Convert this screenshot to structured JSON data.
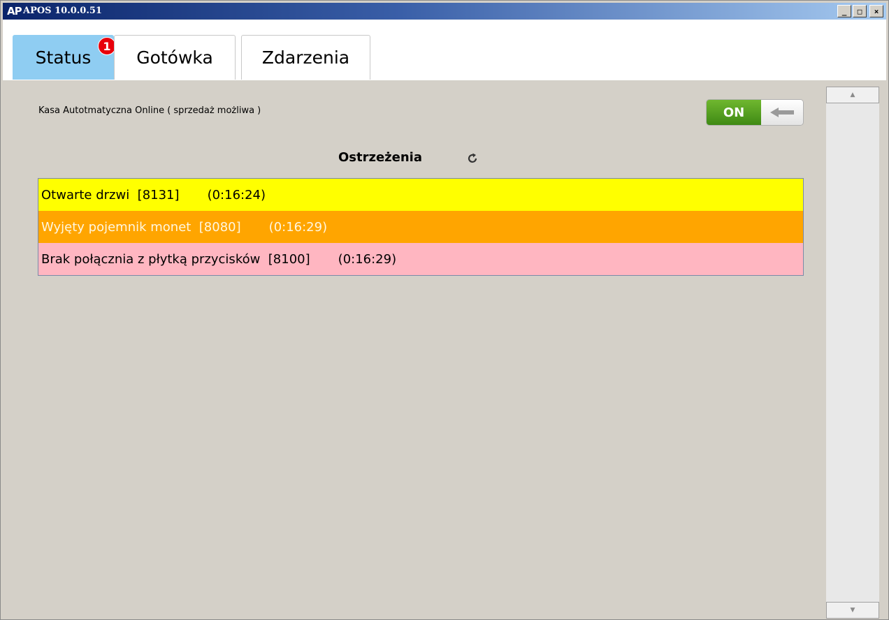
{
  "window": {
    "logo": "AP",
    "title": "APOS 10.0.0.51",
    "min_glyph": "_",
    "max_glyph": "□",
    "close_glyph": "×"
  },
  "tabs": [
    {
      "label": "Status",
      "badge": "1",
      "active": true
    },
    {
      "label": "Gotówka",
      "active": false
    },
    {
      "label": "Zdarzenia",
      "active": false
    }
  ],
  "status": {
    "text": "Kasa Autotmatyczna Online ( sprzedaż możliwa )",
    "toggle_label": "ON"
  },
  "warnings": {
    "title": "Ostrzeżenia",
    "items": [
      {
        "text": "Otwarte drzwi  [8131]       (0:16:24)",
        "color": "#ffff00"
      },
      {
        "text": "Wyjęty pojemnik monet  [8080]       (0:16:29)",
        "color": "#ffa500"
      },
      {
        "text": "Brak połącznia z płytką przycisków  [8100]       (0:16:29)",
        "color": "#ffb6c1"
      }
    ]
  },
  "colors": {
    "active_tab": "#8fcdf2",
    "toggle_on": "#4f9a1f",
    "badge": "#e8000b"
  }
}
